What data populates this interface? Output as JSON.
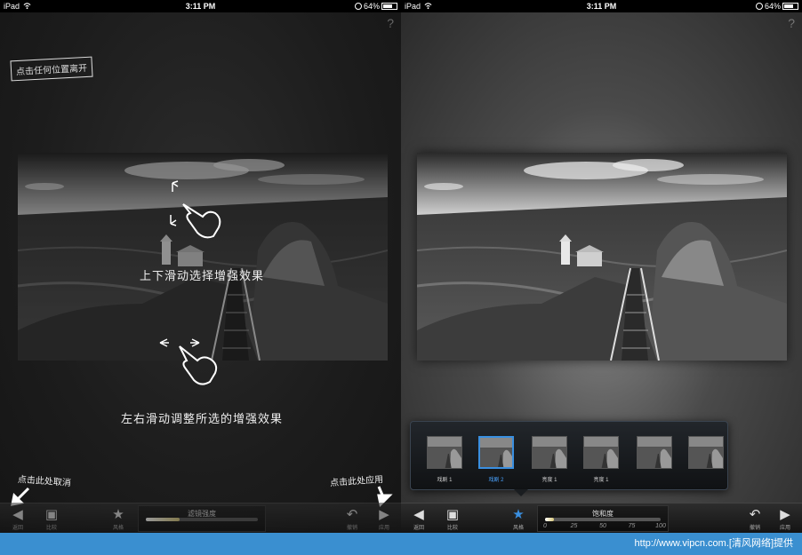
{
  "status_bar": {
    "device": "iPad",
    "time": "3:11 PM",
    "battery": "64%"
  },
  "help_label": "?",
  "tutorial": {
    "exit_hint": "点击任何位置离开",
    "vertical_hint": "上下滑动选择增强效果",
    "horizontal_hint": "左右滑动调整所选的增强效果",
    "cancel_hint": "点击此处取消",
    "apply_hint": "点击此处应用",
    "slider_label": "滤镜强度"
  },
  "toolbar": {
    "back_label": "返回",
    "compare_label": "比较",
    "style_label": "风格",
    "undo_label": "撤销",
    "apply_label": "应用",
    "slider_label": "饱和度",
    "slider_ticks": [
      "0",
      "25",
      "50",
      "75",
      "100"
    ],
    "slider_level": 0.08
  },
  "styles": [
    {
      "name": "戏剧 1"
    },
    {
      "name": "戏剧 2",
      "selected": true
    },
    {
      "name": "亮度 1"
    },
    {
      "name": "亮度 1"
    },
    {
      "name": ""
    },
    {
      "name": ""
    }
  ],
  "colors": {
    "accent": "#3a8fe0",
    "watermark_bg": "#3a8fd0"
  },
  "watermark_text": "http://www.vipcn.com.[清风网络]提供"
}
